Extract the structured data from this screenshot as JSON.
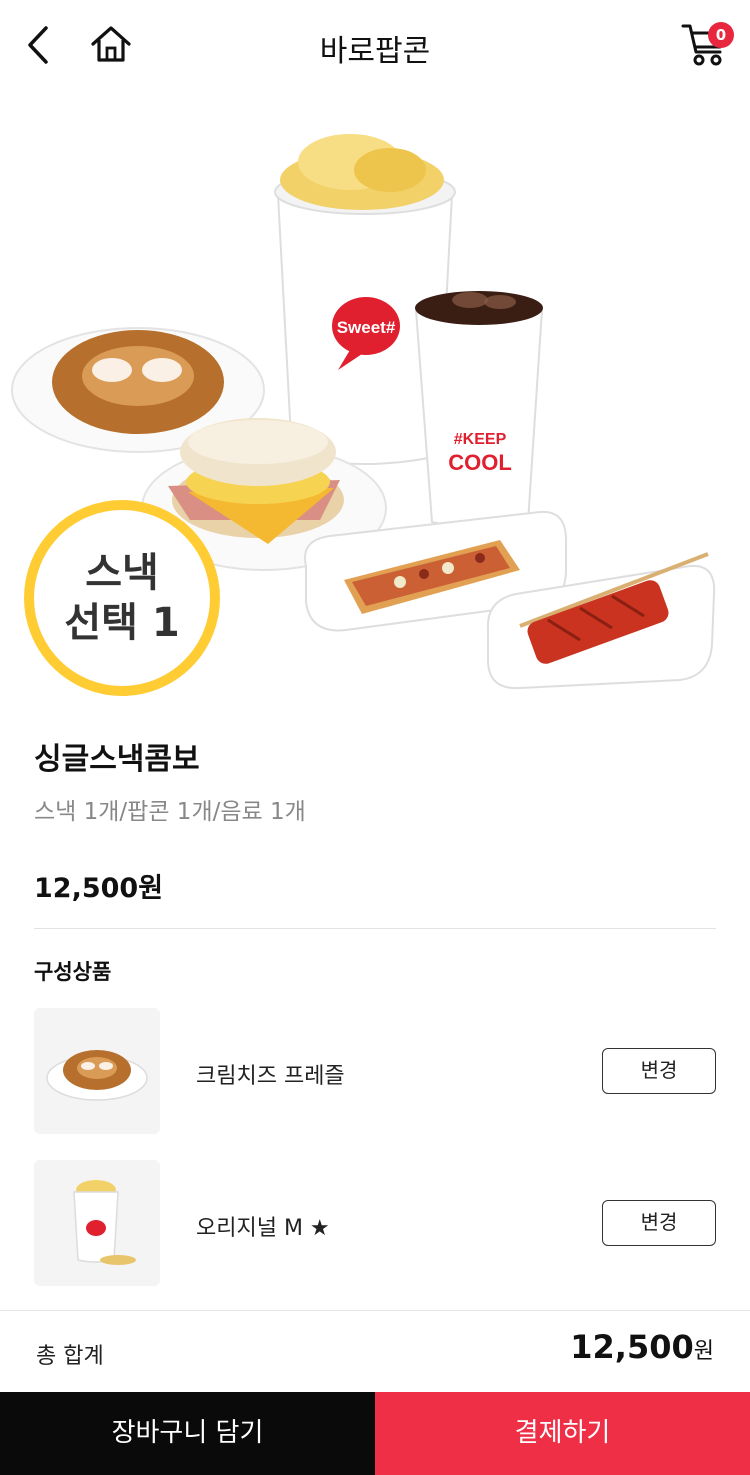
{
  "header": {
    "title": "바로팝콘",
    "cart_count": "0",
    "back_icon": "chevron-left-icon",
    "home_icon": "home-icon",
    "cart_icon": "cart-icon"
  },
  "hero": {
    "badge_line1": "스낵",
    "badge_line2": "선택 1",
    "cup_logo": "Sweet#",
    "drink_text_1": "#KEEP",
    "drink_text_2": "COOL",
    "badge_color": "#ffcc33"
  },
  "product": {
    "name": "싱글스낵콤보",
    "description": "스낵 1개/팝콘 1개/음료 1개",
    "price": "12,500원"
  },
  "components": {
    "title": "구성상품",
    "items": [
      {
        "name": "크림치즈 프레즐",
        "change_label": "변경"
      },
      {
        "name": "오리지널 M ★",
        "change_label": "변경"
      }
    ]
  },
  "total": {
    "label": "총 합계",
    "amount": "12,500",
    "unit": "원"
  },
  "actions": {
    "add_to_cart": "장바구니 담기",
    "checkout": "결제하기"
  },
  "colors": {
    "accent": "#ee2f46",
    "dark": "#0a0a0a"
  }
}
